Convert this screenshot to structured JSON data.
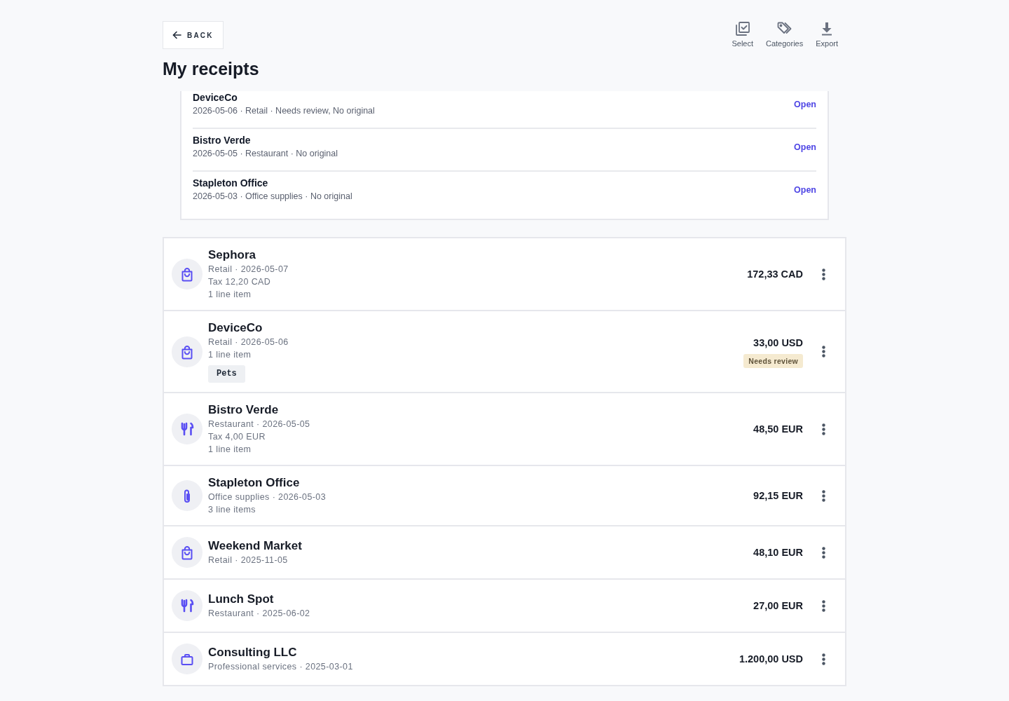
{
  "header": {
    "back_button": "BACK",
    "title": "My receipts",
    "toolbar": [
      {
        "kind": "select",
        "label": "Select"
      },
      {
        "kind": "categories",
        "label": "Categories"
      },
      {
        "kind": "export",
        "label": "Export"
      }
    ]
  },
  "review_panel": {
    "items": [
      {
        "name": "DeviceCo",
        "details": "2026-05-06 · Retail · Needs review, No original",
        "action": "Open"
      },
      {
        "name": "Bistro Verde",
        "details": "2026-05-05 · Restaurant · No original",
        "action": "Open"
      },
      {
        "name": "Stapleton Office",
        "details": "2026-05-03 · Office supplies · No original",
        "action": "Open"
      }
    ]
  },
  "receipts": [
    {
      "kind": "retail",
      "merchant": "Sephora",
      "lines": [
        "Retail · 2026-05-07",
        "Tax 12,20 CAD",
        "1 line item"
      ],
      "amount": "172,33 CAD"
    },
    {
      "kind": "retail",
      "merchant": "DeviceCo",
      "lines": [
        "Retail · 2026-05-06",
        "1 line item"
      ],
      "tags": [
        "Pets"
      ],
      "amount": "33,00 USD",
      "status": "Needs review"
    },
    {
      "kind": "restaurant",
      "merchant": "Bistro Verde",
      "lines": [
        "Restaurant · 2026-05-05",
        "Tax 4,00 EUR",
        "1 line item"
      ],
      "amount": "48,50 EUR"
    },
    {
      "kind": "office",
      "merchant": "Stapleton Office",
      "lines": [
        "Office supplies · 2026-05-03",
        "3 line items"
      ],
      "amount": "92,15 EUR"
    },
    {
      "kind": "retail",
      "merchant": "Weekend Market",
      "lines": [
        "Retail · 2025-11-05"
      ],
      "amount": "48,10 EUR"
    },
    {
      "kind": "restaurant",
      "merchant": "Lunch Spot",
      "lines": [
        "Restaurant · 2025-06-02"
      ],
      "amount": "27,00 EUR"
    },
    {
      "kind": "services",
      "merchant": "Consulting LLC",
      "lines": [
        "Professional services · 2025-03-01"
      ],
      "amount": "1.200,00 USD"
    }
  ]
}
